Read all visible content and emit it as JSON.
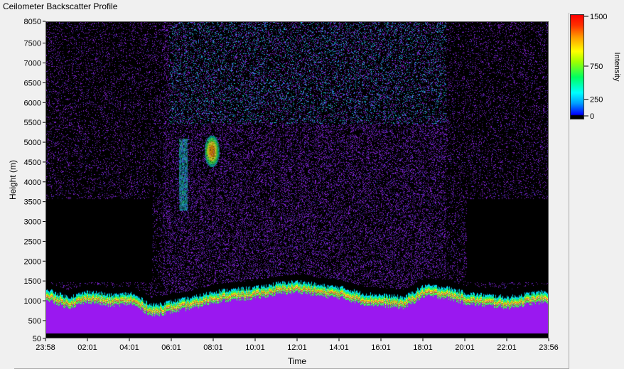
{
  "window": {
    "title": "Ceilometer Backscatter Profile"
  },
  "chart_data": {
    "type": "heatmap",
    "title": "Ceilometer Backscatter Profile",
    "xlabel": "Time",
    "ylabel": "Height (m)",
    "x_ticks": [
      "23:58",
      "02:01",
      "04:01",
      "06:01",
      "08:01",
      "10:01",
      "12:01",
      "14:01",
      "16:01",
      "18:01",
      "20:01",
      "22:01",
      "23:56"
    ],
    "y_ticks": [
      50,
      500,
      1000,
      1500,
      2000,
      2500,
      3000,
      3500,
      4000,
      4500,
      5000,
      5500,
      6000,
      6500,
      7000,
      7500,
      8050
    ],
    "ylim": [
      50,
      8050
    ],
    "xlim_hours": [
      -0.0333,
      23.9333
    ],
    "colorbar": {
      "label": "Intensity",
      "ticks": [
        0,
        250,
        750,
        1500
      ],
      "range": [
        0,
        1500
      ]
    },
    "features": {
      "boundary_layer_top_m": [
        [
          0,
          1300
        ],
        [
          1,
          1100
        ],
        [
          2,
          1250
        ],
        [
          3,
          1150
        ],
        [
          4,
          1200
        ],
        [
          5,
          900
        ],
        [
          6,
          1000
        ],
        [
          7,
          1100
        ],
        [
          8,
          1250
        ],
        [
          9,
          1300
        ],
        [
          10,
          1350
        ],
        [
          11,
          1450
        ],
        [
          12,
          1500
        ],
        [
          13,
          1400
        ],
        [
          14,
          1350
        ],
        [
          15,
          1200
        ],
        [
          16,
          1150
        ],
        [
          17,
          1100
        ],
        [
          18,
          1400
        ],
        [
          19,
          1350
        ],
        [
          20,
          1200
        ],
        [
          21,
          1150
        ],
        [
          22,
          1100
        ],
        [
          23,
          1200
        ],
        [
          23.9,
          1250
        ]
      ],
      "cloud_layer": {
        "time_hours": [
          7.5,
          8.2
        ],
        "height_m": [
          4400,
          5200
        ],
        "peak_intensity": 1000
      },
      "virga_streak": {
        "time_hours": [
          6.3,
          6.7
        ],
        "height_m": [
          3300,
          5100
        ],
        "peak_intensity": 300
      }
    }
  }
}
